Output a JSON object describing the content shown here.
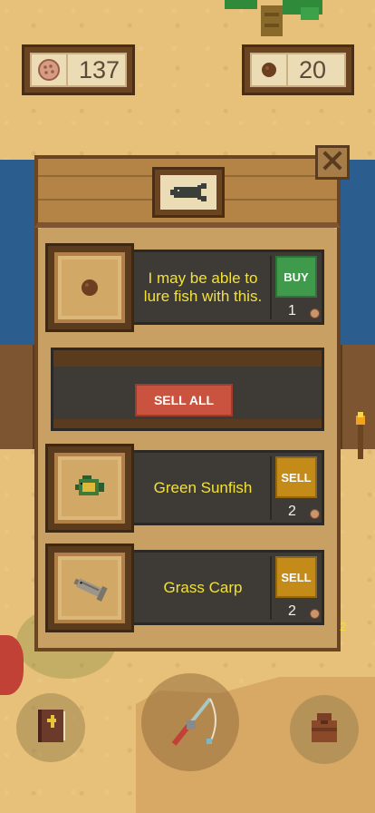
{
  "counters": {
    "bait": {
      "icon": "bait-icon",
      "value": "137"
    },
    "coins": {
      "icon": "coin-icon",
      "value": "20"
    }
  },
  "shop": {
    "header_icon": "fish-icon",
    "close_icon": "close-icon",
    "items": [
      {
        "icon": "bait-ball-icon",
        "text": "I may be able to lure fish with this.",
        "action": "BUY",
        "price": "1",
        "price_icon": "bait-icon"
      },
      {
        "icon": "green-sunfish-icon",
        "text": "Green Sunfish",
        "action": "SELL",
        "price": "2",
        "price_icon": "bait-icon"
      },
      {
        "icon": "grass-carp-icon",
        "text": "Grass Carp",
        "action": "SELL",
        "price": "2",
        "price_icon": "bait-icon"
      }
    ],
    "sell_all_label": "SELL ALL",
    "list_count": "2"
  },
  "bottom_bar": {
    "journal_icon": "journal-icon",
    "fishing_rod_icon": "fishing-rod-icon",
    "bag_icon": "bag-icon"
  },
  "colors": {
    "buy": "#3f9b4b",
    "sell": "#c48b19",
    "sell_all": "#c9533f",
    "item_text": "#f2e13a"
  }
}
